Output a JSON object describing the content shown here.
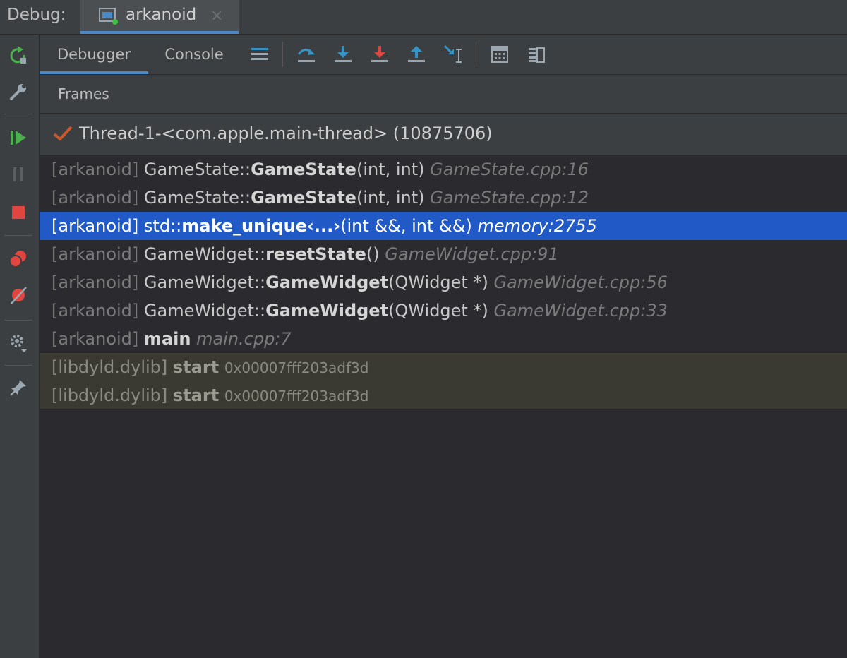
{
  "topbar": {
    "debug_label": "Debug:",
    "session_tab": {
      "label": "arkanoid",
      "close": "×"
    }
  },
  "panel_tabs": [
    {
      "label": "Debugger",
      "active": true
    },
    {
      "label": "Console",
      "active": false
    }
  ],
  "toolbar_icons": [
    "show-execution-point-icon",
    "step-over-icon",
    "step-into-icon",
    "force-step-into-icon",
    "step-out-icon",
    "run-to-cursor-icon",
    "evaluate-expression-icon",
    "restore-layout-icon"
  ],
  "sidebar_icons": [
    "rerun-icon",
    "wrench-icon",
    "resume-icon",
    "pause-icon",
    "stop-icon",
    "view-breakpoints-icon",
    "mute-breakpoints-icon",
    "settings-icon",
    "pin-icon"
  ],
  "frames_header": {
    "title": "Frames"
  },
  "thread": {
    "label": "Thread-1-<com.apple.main-thread> (10875706)"
  },
  "frames": [
    {
      "module": "[arkanoid]",
      "cls": "GameState::",
      "fn": "GameState",
      "args": "(int, int)",
      "loc": "GameState.cpp:16"
    },
    {
      "module": "[arkanoid]",
      "cls": "GameState::",
      "fn": "GameState",
      "args": "(int, int)",
      "loc": "GameState.cpp:12"
    },
    {
      "module": "[arkanoid]",
      "cls": "std::",
      "fn": "make_unique‹...›",
      "args": "(int &&, int &&)",
      "loc": "memory:2755"
    },
    {
      "module": "[arkanoid]",
      "cls": "GameWidget::",
      "fn": "resetState",
      "args": "()",
      "loc": "GameWidget.cpp:91"
    },
    {
      "module": "[arkanoid]",
      "cls": "GameWidget::",
      "fn": "GameWidget",
      "args": "(QWidget *)",
      "loc": "GameWidget.cpp:56"
    },
    {
      "module": "[arkanoid]",
      "cls": "GameWidget::",
      "fn": "GameWidget",
      "args": "(QWidget *)",
      "loc": "GameWidget.cpp:33"
    },
    {
      "module": "[arkanoid]",
      "cls": "",
      "fn": "main",
      "args": "",
      "loc": "main.cpp:7"
    }
  ],
  "library_frames": [
    {
      "module": "[libdyld.dylib]",
      "fn": "start",
      "addr": "0x00007fff203adf3d"
    },
    {
      "module": "[libdyld.dylib]",
      "fn": "start",
      "addr": "0x00007fff203adf3d"
    }
  ],
  "colors": {
    "selection": "#2159c6",
    "accent": "#4a88c7",
    "library_row": "#3b3a32",
    "resume_green": "#4caf50",
    "stop_red": "#e0453f"
  }
}
